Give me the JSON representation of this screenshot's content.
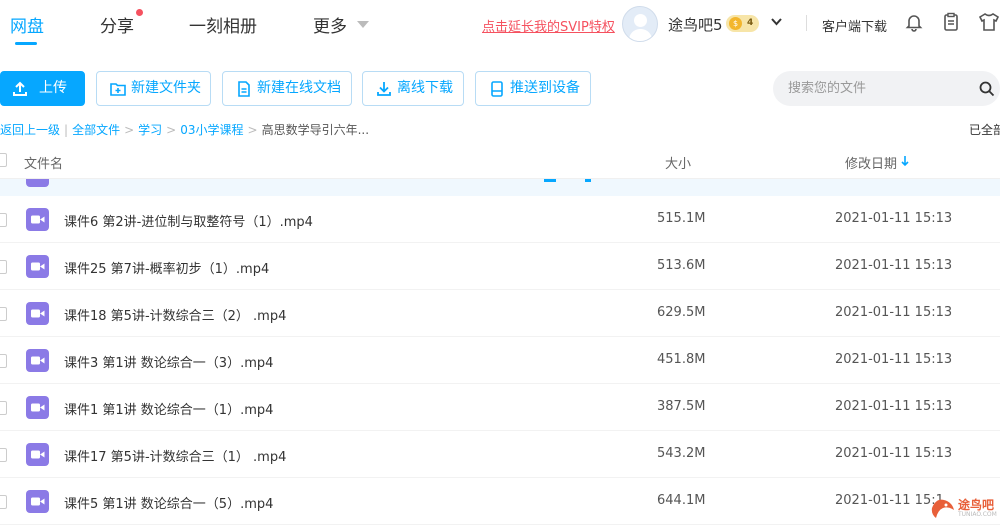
{
  "nav": {
    "tabs": [
      {
        "label": "网盘",
        "active": true
      },
      {
        "label": "分享",
        "active": false,
        "has_dot": true
      },
      {
        "label": "一刻相册",
        "active": false
      },
      {
        "label": "更多",
        "active": false
      }
    ],
    "svip_link": "点击延长我的SVIP特权",
    "username": "途鸟吧5",
    "coin_symbol": "$",
    "coin_count": "4",
    "client_download": "客户端下载",
    "icons": [
      "bell-icon",
      "clipboard-icon",
      "shirt-icon"
    ]
  },
  "toolbar": {
    "upload": "上传",
    "new_folder": "新建文件夹",
    "new_online_doc": "新建在线文档",
    "offline_download": "离线下载",
    "push_to_device": "推送到设备",
    "search_placeholder": "搜索您的文件"
  },
  "breadcrumb": {
    "back": "返回上一级",
    "items": [
      "全部文件",
      "学习",
      "03小学课程"
    ],
    "current": "高思数学导引六年...",
    "loaded_all": "已全部"
  },
  "table": {
    "columns": {
      "name": "文件名",
      "size": "大小",
      "modified": "修改日期"
    },
    "sort": {
      "column": "modified",
      "direction": "desc"
    },
    "rows": [
      {
        "name": "课件6 第2讲-进位制与取整符号（1）.mp4",
        "size": "515.1M",
        "date": "2021-01-11 15:13"
      },
      {
        "name": "课件25 第7讲-概率初步（1）.mp4",
        "size": "513.6M",
        "date": "2021-01-11 15:13"
      },
      {
        "name": "课件18 第5讲-计数综合三（2） .mp4",
        "size": "629.5M",
        "date": "2021-01-11 15:13"
      },
      {
        "name": "课件3 第1讲 数论综合一（3）.mp4",
        "size": "451.8M",
        "date": "2021-01-11 15:13"
      },
      {
        "name": "课件1 第1讲 数论综合一（1）.mp4",
        "size": "387.5M",
        "date": "2021-01-11 15:13"
      },
      {
        "name": "课件17 第5讲-计数综合三（1） .mp4",
        "size": "543.2M",
        "date": "2021-01-11 15:13"
      },
      {
        "name": "课件5 第1讲 数论综合一（5）.mp4",
        "size": "644.1M",
        "date": "2021-01-11 15:1"
      }
    ]
  },
  "watermark": {
    "text": "途鸟吧",
    "sub": "TUNIAO.COM"
  },
  "colors": {
    "accent": "#06a7ff",
    "video_icon": "#8b7ae6",
    "link_red": "#f5515f"
  }
}
